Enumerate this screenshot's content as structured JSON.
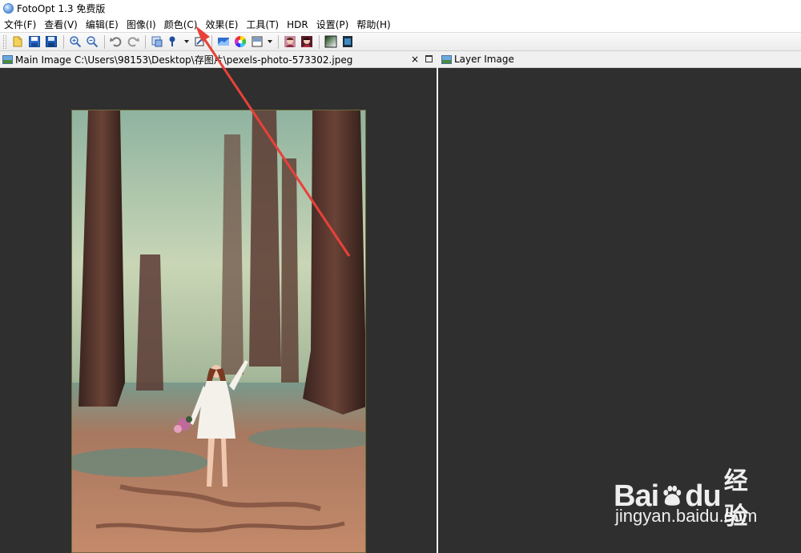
{
  "window": {
    "title": "FotoOpt 1.3 免费版"
  },
  "menu": [
    {
      "label": "文件(F)"
    },
    {
      "label": "查看(V)"
    },
    {
      "label": "编辑(E)"
    },
    {
      "label": "图像(I)"
    },
    {
      "label": "颜色(C)"
    },
    {
      "label": "效果(E)"
    },
    {
      "label": "工具(T)"
    },
    {
      "label": "HDR"
    },
    {
      "label": "设置(P)"
    },
    {
      "label": "帮助(H)"
    }
  ],
  "toolbar": {
    "buttons": [
      "open-icon",
      "save-icon",
      "save-as-icon",
      "zoom-in-icon",
      "zoom-out-icon",
      "undo-icon",
      "redo-icon",
      "crop-icon",
      "brush-icon",
      "rotate-icon",
      "levels-icon",
      "color-wheel-icon",
      "filter-icon",
      "portrait-icon",
      "portrait-alt-icon",
      "gradient-icon",
      "film-icon"
    ]
  },
  "panels": {
    "main": {
      "title": "Main Image C:\\Users\\98153\\Desktop\\存图片\\pexels-photo-573302.jpeg",
      "close_glyph": "×"
    },
    "layer": {
      "title": "Layer Image"
    }
  },
  "watermark": {
    "brand_latin": "Bai",
    "brand_latin_2": "du",
    "brand_cn": "经验",
    "url": "jingyan.baidu.com"
  },
  "colors": {
    "canvas_bg": "#2f2f2f",
    "annotation_arrow": "#e8413a"
  }
}
